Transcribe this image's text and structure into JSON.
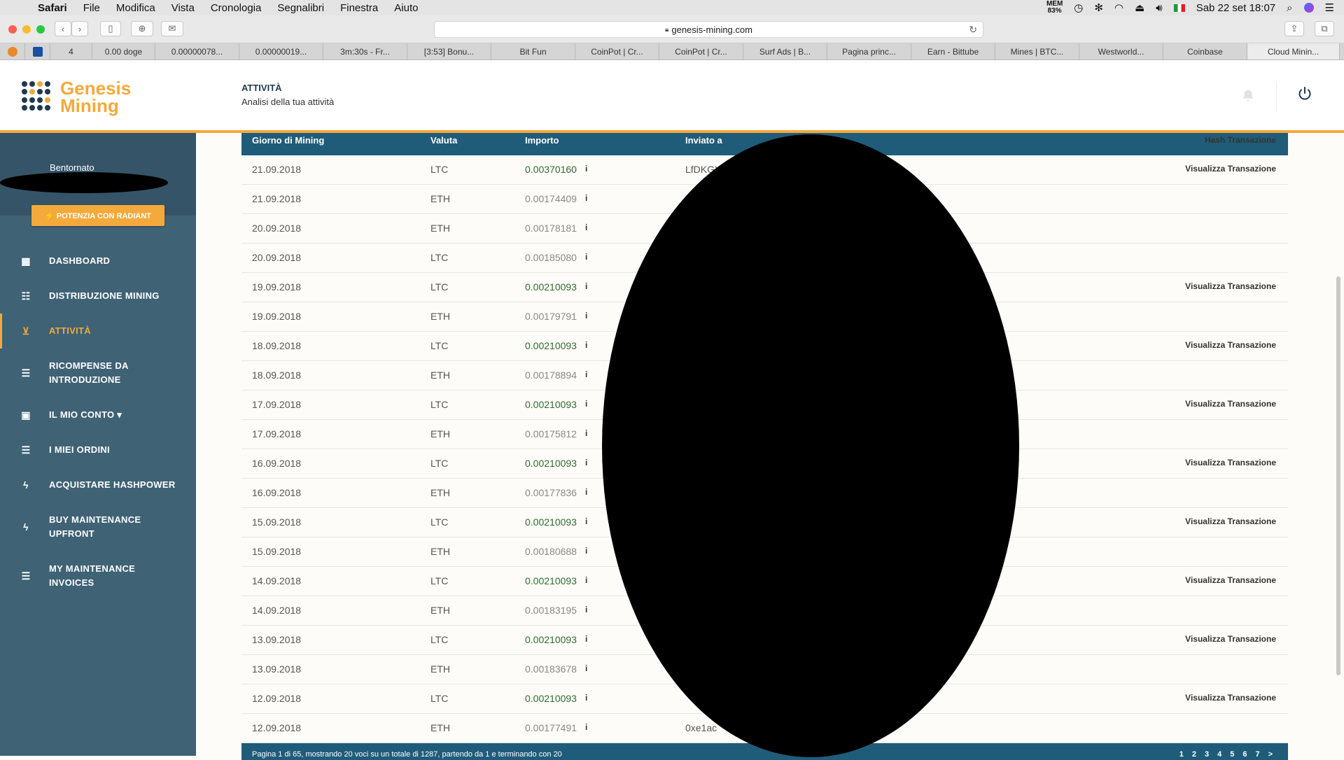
{
  "menubar": {
    "items": [
      "Safari",
      "File",
      "Modifica",
      "Vista",
      "Cronologia",
      "Segnalibri",
      "Finestra",
      "Aiuto"
    ],
    "mem_label": "MEM",
    "mem_value": "83%",
    "datetime": "Sab 22 set  18:07"
  },
  "browser": {
    "url": "genesis-mining.com",
    "tabs": [
      "4",
      "0.00 doge",
      "0.00000078...",
      "0.00000019...",
      "3m:30s - Fr...",
      "[3:53] Bonu...",
      "Bit Fun",
      "CoinPot | Cr...",
      "CoinPot | Cr...",
      "Surf Ads | B...",
      "Pagina princ...",
      "Earn - Bittube",
      "Mines | BTC...",
      "Westworld...",
      "Coinbase",
      "Cloud Minin..."
    ],
    "new_tab": "+"
  },
  "app": {
    "logo_line1": "Genesis",
    "logo_line2": "Mining",
    "page_title": "ATTIVITÀ",
    "page_subtitle": "Analisi della tua attività"
  },
  "sidebar": {
    "greeting": "Bentornato",
    "radiant_button": "⚡ POTENZIA CON RADIANT",
    "items": [
      {
        "label": "DASHBOARD"
      },
      {
        "label": "DISTRIBUZIONE MINING"
      },
      {
        "label": "ATTIVITÀ"
      },
      {
        "label": "RICOMPENSE DA\nINTRODUZIONE"
      },
      {
        "label": "IL MIO CONTO ▾"
      },
      {
        "label": "I MIEI ORDINI"
      },
      {
        "label": "ACQUISTARE HASHPOWER"
      },
      {
        "label": "BUY MAINTENANCE\nUPFRONT"
      },
      {
        "label": "MY MAINTENANCE\nINVOICES"
      }
    ]
  },
  "table": {
    "headers": {
      "date": "Giorno di Mining",
      "currency": "Valuta",
      "amount": "Importo",
      "sent_to": "Inviato a",
      "hash": "Hash Transazione"
    },
    "rows": [
      {
        "date": "21.09.2018",
        "currency": "LTC",
        "amount": "0.00370160",
        "status": "paid",
        "sent_to": "LfDKGY",
        "hash": "Visualizza Transazione"
      },
      {
        "date": "21.09.2018",
        "currency": "ETH",
        "amount": "0.00174409",
        "status": "pend",
        "sent_to": "",
        "hash": ""
      },
      {
        "date": "20.09.2018",
        "currency": "ETH",
        "amount": "0.00178181",
        "status": "pend",
        "sent_to": "",
        "hash": ""
      },
      {
        "date": "20.09.2018",
        "currency": "LTC",
        "amount": "0.00185080",
        "status": "pend",
        "sent_to": "",
        "hash": ""
      },
      {
        "date": "19.09.2018",
        "currency": "LTC",
        "amount": "0.00210093",
        "status": "paid",
        "sent_to": "",
        "hash": "Visualizza Transazione"
      },
      {
        "date": "19.09.2018",
        "currency": "ETH",
        "amount": "0.00179791",
        "status": "pend",
        "sent_to": "",
        "hash": ""
      },
      {
        "date": "18.09.2018",
        "currency": "LTC",
        "amount": "0.00210093",
        "status": "paid",
        "sent_to": "",
        "hash": "Visualizza Transazione"
      },
      {
        "date": "18.09.2018",
        "currency": "ETH",
        "amount": "0.00178894",
        "status": "pend",
        "sent_to": "",
        "hash": ""
      },
      {
        "date": "17.09.2018",
        "currency": "LTC",
        "amount": "0.00210093",
        "status": "paid",
        "sent_to": "",
        "hash": "Visualizza Transazione"
      },
      {
        "date": "17.09.2018",
        "currency": "ETH",
        "amount": "0.00175812",
        "status": "pend",
        "sent_to": "",
        "hash": ""
      },
      {
        "date": "16.09.2018",
        "currency": "LTC",
        "amount": "0.00210093",
        "status": "paid",
        "sent_to": "",
        "hash": "Visualizza Transazione"
      },
      {
        "date": "16.09.2018",
        "currency": "ETH",
        "amount": "0.00177836",
        "status": "pend",
        "sent_to": "",
        "hash": ""
      },
      {
        "date": "15.09.2018",
        "currency": "LTC",
        "amount": "0.00210093",
        "status": "paid",
        "sent_to": "",
        "hash": "Visualizza Transazione"
      },
      {
        "date": "15.09.2018",
        "currency": "ETH",
        "amount": "0.00180688",
        "status": "pend",
        "sent_to": "",
        "hash": ""
      },
      {
        "date": "14.09.2018",
        "currency": "LTC",
        "amount": "0.00210093",
        "status": "paid",
        "sent_to": "",
        "hash": "Visualizza Transazione"
      },
      {
        "date": "14.09.2018",
        "currency": "ETH",
        "amount": "0.00183195",
        "status": "pend",
        "sent_to": "",
        "hash": ""
      },
      {
        "date": "13.09.2018",
        "currency": "LTC",
        "amount": "0.00210093",
        "status": "paid",
        "sent_to": "",
        "hash": "Visualizza Transazione"
      },
      {
        "date": "13.09.2018",
        "currency": "ETH",
        "amount": "0.00183678",
        "status": "pend",
        "sent_to": "",
        "hash": ""
      },
      {
        "date": "12.09.2018",
        "currency": "LTC",
        "amount": "0.00210093",
        "status": "paid",
        "sent_to": "",
        "hash": "Visualizza Transazione"
      },
      {
        "date": "12.09.2018",
        "currency": "ETH",
        "amount": "0.00177491",
        "status": "pend",
        "sent_to": "0xe1ac",
        "hash": ""
      }
    ],
    "info_glyph": "i",
    "footer_text": "Pagina 1 di 65, mostrando 20 voci su un totale di 1287, partendo da 1 e terminando con 20",
    "pages": [
      "1",
      "2",
      "3",
      "4",
      "5",
      "6",
      "7",
      ">"
    ]
  },
  "colors": {
    "accent": "#f4a93b",
    "sidebar": "#3f6275",
    "table_header": "#1f5c7a",
    "paid_amount": "#2f6b2f"
  }
}
